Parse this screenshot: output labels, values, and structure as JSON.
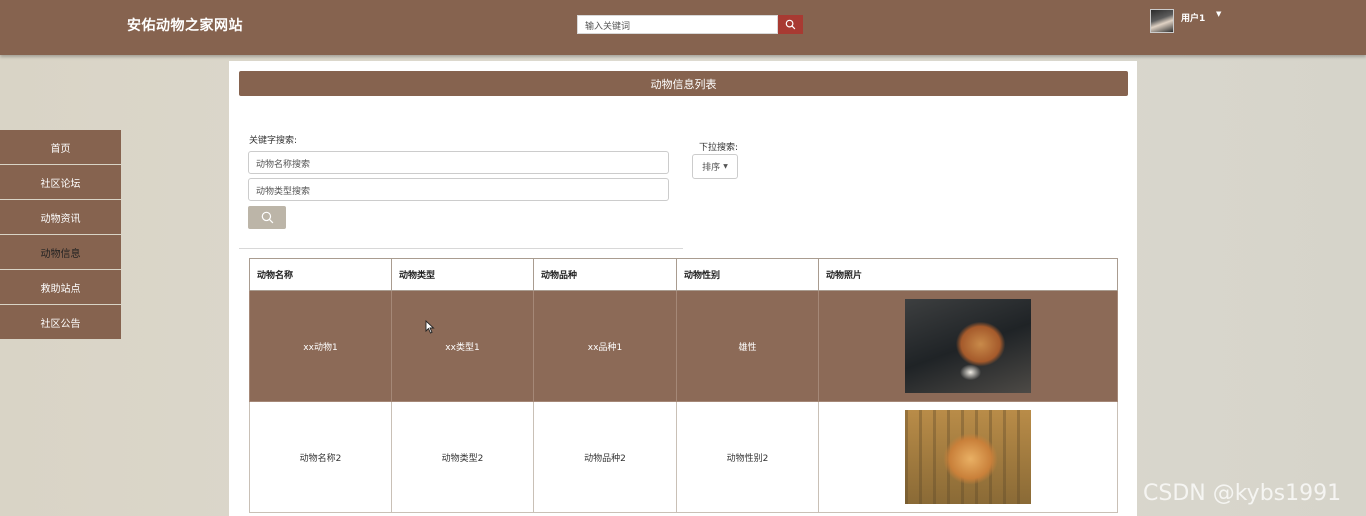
{
  "header": {
    "site_title": "安佑动物之家网站",
    "search_placeholder": "输入关键词",
    "username": "用户1"
  },
  "sidebar": {
    "items": [
      {
        "label": "首页"
      },
      {
        "label": "社区论坛"
      },
      {
        "label": "动物资讯"
      },
      {
        "label": "动物信息",
        "active": true
      },
      {
        "label": "救助站点"
      },
      {
        "label": "社区公告"
      }
    ]
  },
  "main": {
    "panel_title": "动物信息列表",
    "keyword_label": "关键字搜索:",
    "name_placeholder": "动物名称搜索",
    "type_placeholder": "动物类型搜索",
    "dropdown_label": "下拉搜索:",
    "sort_label": "排序",
    "table": {
      "headers": [
        "动物名称",
        "动物类型",
        "动物品种",
        "动物性别",
        "动物照片"
      ],
      "rows": [
        {
          "name": "xx动物1",
          "type": "xx类型1",
          "breed": "xx品种1",
          "gender": "雄性"
        },
        {
          "name": "动物名称2",
          "type": "动物类型2",
          "breed": "动物品种2",
          "gender": "动物性别2"
        }
      ]
    }
  },
  "watermark": "CSDN @kybs1991",
  "colors": {
    "header_brown": "#86634f",
    "highlight_row": "#8c6a57",
    "search_red": "#a83a32"
  }
}
